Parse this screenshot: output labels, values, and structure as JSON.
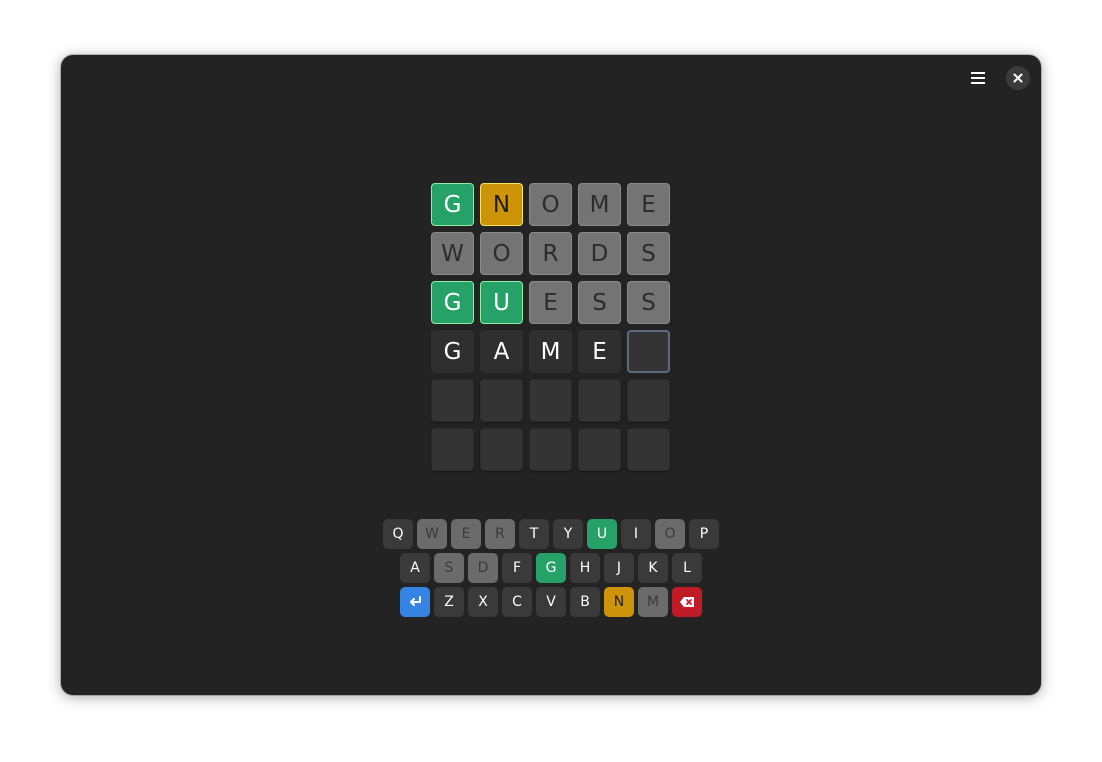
{
  "header": {
    "menu_icon": "hamburger-menu-icon",
    "close_icon": "close-icon"
  },
  "board": {
    "rows": [
      [
        {
          "letter": "G",
          "state": "correct"
        },
        {
          "letter": "N",
          "state": "present"
        },
        {
          "letter": "O",
          "state": "absent"
        },
        {
          "letter": "M",
          "state": "absent"
        },
        {
          "letter": "E",
          "state": "absent"
        }
      ],
      [
        {
          "letter": "W",
          "state": "absent"
        },
        {
          "letter": "O",
          "state": "absent"
        },
        {
          "letter": "R",
          "state": "absent"
        },
        {
          "letter": "D",
          "state": "absent"
        },
        {
          "letter": "S",
          "state": "absent"
        }
      ],
      [
        {
          "letter": "G",
          "state": "correct"
        },
        {
          "letter": "U",
          "state": "correct"
        },
        {
          "letter": "E",
          "state": "absent"
        },
        {
          "letter": "S",
          "state": "absent"
        },
        {
          "letter": "S",
          "state": "absent"
        }
      ],
      [
        {
          "letter": "G",
          "state": "typed"
        },
        {
          "letter": "A",
          "state": "typed"
        },
        {
          "letter": "M",
          "state": "typed"
        },
        {
          "letter": "E",
          "state": "typed"
        },
        {
          "letter": "",
          "state": "cursor"
        }
      ],
      [
        {
          "letter": "",
          "state": "empty"
        },
        {
          "letter": "",
          "state": "empty"
        },
        {
          "letter": "",
          "state": "empty"
        },
        {
          "letter": "",
          "state": "empty"
        },
        {
          "letter": "",
          "state": "empty"
        }
      ],
      [
        {
          "letter": "",
          "state": "empty"
        },
        {
          "letter": "",
          "state": "empty"
        },
        {
          "letter": "",
          "state": "empty"
        },
        {
          "letter": "",
          "state": "empty"
        },
        {
          "letter": "",
          "state": "empty"
        }
      ]
    ]
  },
  "keyboard": {
    "rows": [
      [
        {
          "label": "Q",
          "state": "unused"
        },
        {
          "label": "W",
          "state": "absent"
        },
        {
          "label": "E",
          "state": "absent"
        },
        {
          "label": "R",
          "state": "absent"
        },
        {
          "label": "T",
          "state": "unused"
        },
        {
          "label": "Y",
          "state": "unused"
        },
        {
          "label": "U",
          "state": "correct"
        },
        {
          "label": "I",
          "state": "unused"
        },
        {
          "label": "O",
          "state": "absent"
        },
        {
          "label": "P",
          "state": "unused"
        }
      ],
      [
        {
          "label": "A",
          "state": "unused"
        },
        {
          "label": "S",
          "state": "absent"
        },
        {
          "label": "D",
          "state": "absent"
        },
        {
          "label": "F",
          "state": "unused"
        },
        {
          "label": "G",
          "state": "correct"
        },
        {
          "label": "H",
          "state": "unused"
        },
        {
          "label": "J",
          "state": "unused"
        },
        {
          "label": "K",
          "state": "unused"
        },
        {
          "label": "L",
          "state": "unused"
        }
      ],
      [
        {
          "label": "",
          "state": "enter",
          "icon": "enter-icon"
        },
        {
          "label": "Z",
          "state": "unused"
        },
        {
          "label": "X",
          "state": "unused"
        },
        {
          "label": "C",
          "state": "unused"
        },
        {
          "label": "V",
          "state": "unused"
        },
        {
          "label": "B",
          "state": "unused"
        },
        {
          "label": "N",
          "state": "present"
        },
        {
          "label": "M",
          "state": "absent"
        },
        {
          "label": "",
          "state": "back",
          "icon": "backspace-icon"
        }
      ]
    ]
  },
  "colors": {
    "correct": "#26a269",
    "present": "#cd9309",
    "absent": "#747474",
    "enter": "#3584e4",
    "backspace": "#c01c28"
  }
}
